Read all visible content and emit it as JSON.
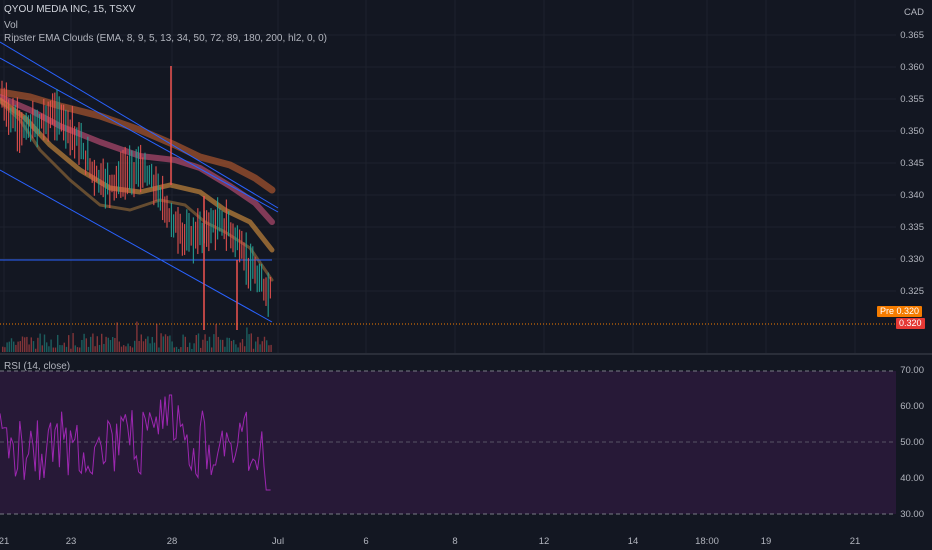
{
  "symbol_title": "QYOU MEDIA INC, 15, TSXV",
  "volume_label": "Vol",
  "indicator_label": "Ripster EMA Clouds (EMA, 8, 9, 5, 13, 34, 50, 72, 89, 180, 200, hl2, 0, 0)",
  "rsi_label": "RSI (14, close)",
  "currency": "CAD",
  "price_axis_ticks": [
    "0.365",
    "0.360",
    "0.355",
    "0.350",
    "0.345",
    "0.340",
    "0.335",
    "0.330",
    "0.325"
  ],
  "rsi_axis_ticks": [
    "70.00",
    "60.00",
    "50.00",
    "40.00",
    "30.00"
  ],
  "time_ticks": [
    "21",
    "23",
    "28",
    "Jul",
    "6",
    "8",
    "12",
    "14",
    "18:00",
    "19",
    "21"
  ],
  "pre_badge": "Pre",
  "pre_price": "0.320",
  "last_price": "0.320",
  "colors": {
    "background": "#131722",
    "up_bar": "#26a69a",
    "down_bar": "#ef5350",
    "trendline": "#2962ff",
    "rsi_line": "#9c27b0",
    "rsi_fill": "#2a1a3a",
    "badge_orange": "#f57c00",
    "badge_red": "#e53935"
  }
}
